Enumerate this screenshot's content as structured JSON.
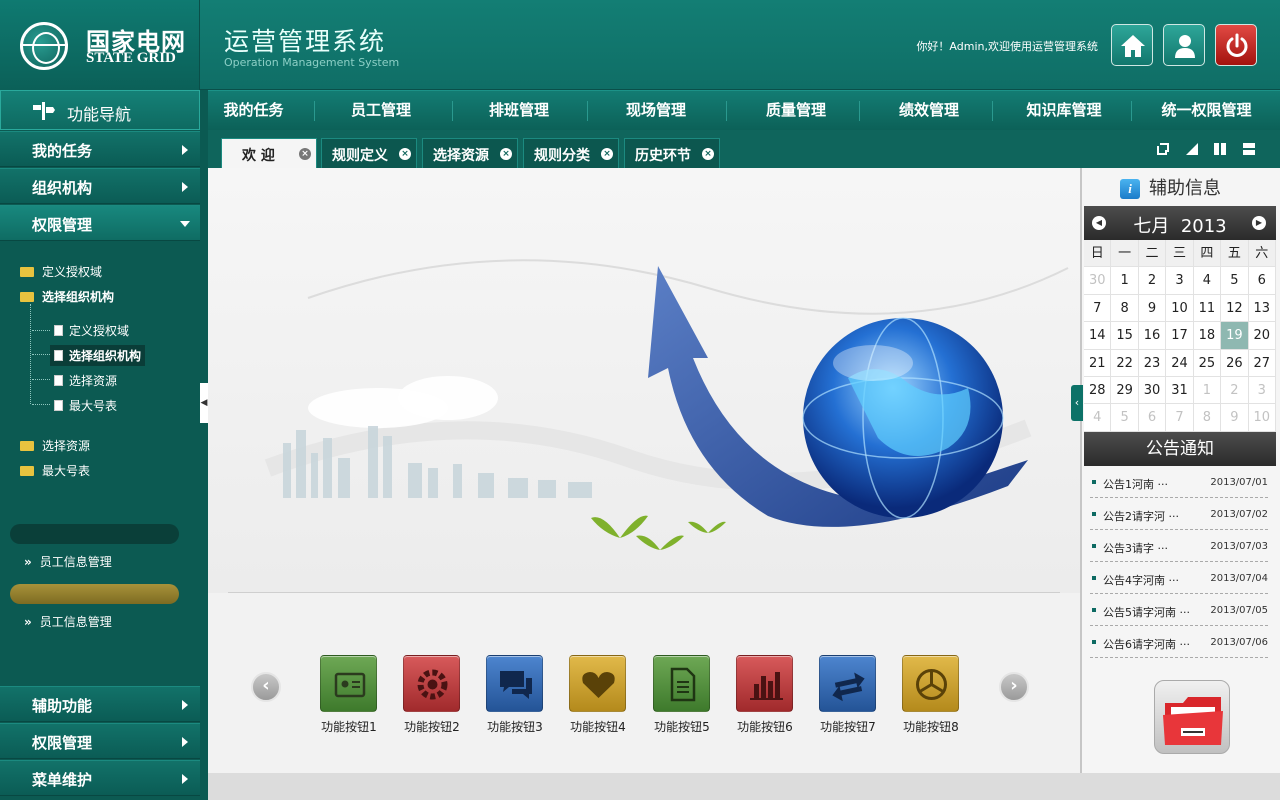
{
  "header": {
    "logo_cn": "国家电网",
    "logo_en": "STATE GRID",
    "system_title": "运营管理系统",
    "system_subtitle": "Operation Management System",
    "welcome_text": "你好！Admin,欢迎使用运营管理系统",
    "buttons": [
      "home-icon",
      "user-icon",
      "power-icon"
    ]
  },
  "nav": {
    "items": [
      "我的任务",
      "员工管理",
      "排班管理",
      "现场管理",
      "质量管理",
      "绩效管理",
      "知识库管理",
      "统一权限管理"
    ]
  },
  "sidebar": {
    "header": "功能导航",
    "menu_top": [
      {
        "label": "我的任务",
        "expanded": false
      },
      {
        "label": "组织机构",
        "expanded": false
      },
      {
        "label": "权限管理",
        "expanded": true
      }
    ],
    "tree": [
      {
        "label": "定义授权域",
        "type": "folder"
      },
      {
        "label": "选择组织机构",
        "type": "folder",
        "bold": true
      },
      {
        "label": "定义授权域",
        "type": "doc"
      },
      {
        "label": "选择组织机构",
        "type": "doc",
        "selected": true
      },
      {
        "label": "选择资源",
        "type": "doc"
      },
      {
        "label": "最大号表",
        "type": "doc"
      },
      {
        "label": "选择资源",
        "type": "folder"
      },
      {
        "label": "最大号表",
        "type": "folder"
      }
    ],
    "sub_links": [
      "员工信息管理",
      "员工信息管理"
    ],
    "menu_bottom": [
      {
        "label": "辅助功能"
      },
      {
        "label": "权限管理"
      },
      {
        "label": "菜单维护"
      }
    ]
  },
  "tabs": [
    {
      "label": "欢 迎",
      "active": true
    },
    {
      "label": "规则定义",
      "active": false
    },
    {
      "label": "选择资源",
      "active": false
    },
    {
      "label": "规则分类",
      "active": false
    },
    {
      "label": "历史环节",
      "active": false
    }
  ],
  "function_buttons": [
    {
      "label": "功能按钮1",
      "icon": "id-card-icon",
      "color": "#4e8a3c"
    },
    {
      "label": "功能按钮2",
      "icon": "gear-icon",
      "color": "#b8383a"
    },
    {
      "label": "功能按钮3",
      "icon": "chat-icon",
      "color": "#2f62a8"
    },
    {
      "label": "功能按钮4",
      "icon": "heart-icon",
      "color": "#c7a02a"
    },
    {
      "label": "功能按钮5",
      "icon": "document-icon",
      "color": "#4e8a3c"
    },
    {
      "label": "功能按钮6",
      "icon": "bar-chart-icon",
      "color": "#b8383a"
    },
    {
      "label": "功能按钮7",
      "icon": "swap-arrows-icon",
      "color": "#2f62a8"
    },
    {
      "label": "功能按钮8",
      "icon": "pie-chart-icon",
      "color": "#c7a02a"
    }
  ],
  "aux_panel": {
    "title": "辅助信息",
    "calendar": {
      "month_label": "七月",
      "year": "2013",
      "weekdays": [
        "日",
        "一",
        "二",
        "三",
        "四",
        "五",
        "六"
      ],
      "days": [
        [
          30,
          1,
          2,
          3,
          4,
          5,
          6
        ],
        [
          7,
          8,
          9,
          10,
          11,
          12,
          13
        ],
        [
          14,
          15,
          16,
          17,
          18,
          19,
          20
        ],
        [
          21,
          22,
          23,
          24,
          25,
          26,
          27
        ],
        [
          28,
          29,
          30,
          31,
          1,
          2,
          3
        ],
        [
          4,
          5,
          6,
          7,
          8,
          9,
          10
        ]
      ],
      "today": 19
    },
    "notice_title": "公告通知",
    "notices": [
      {
        "title": "公告1河南 ···",
        "date": "2013/07/01"
      },
      {
        "title": "公告2请字河 ···",
        "date": "2013/07/02"
      },
      {
        "title": "公告3请字 ···",
        "date": "2013/07/03"
      },
      {
        "title": "公告4字河南 ···",
        "date": "2013/07/04"
      },
      {
        "title": "公告5请字河南 ···",
        "date": "2013/07/05"
      },
      {
        "title": "公告6请字河南 ···",
        "date": "2013/07/06"
      }
    ]
  },
  "colors": {
    "primary": "#0f6e66",
    "sidebar": "#0c5a52",
    "today": "#8fb8b1",
    "gold_pill": "#9a8530"
  }
}
